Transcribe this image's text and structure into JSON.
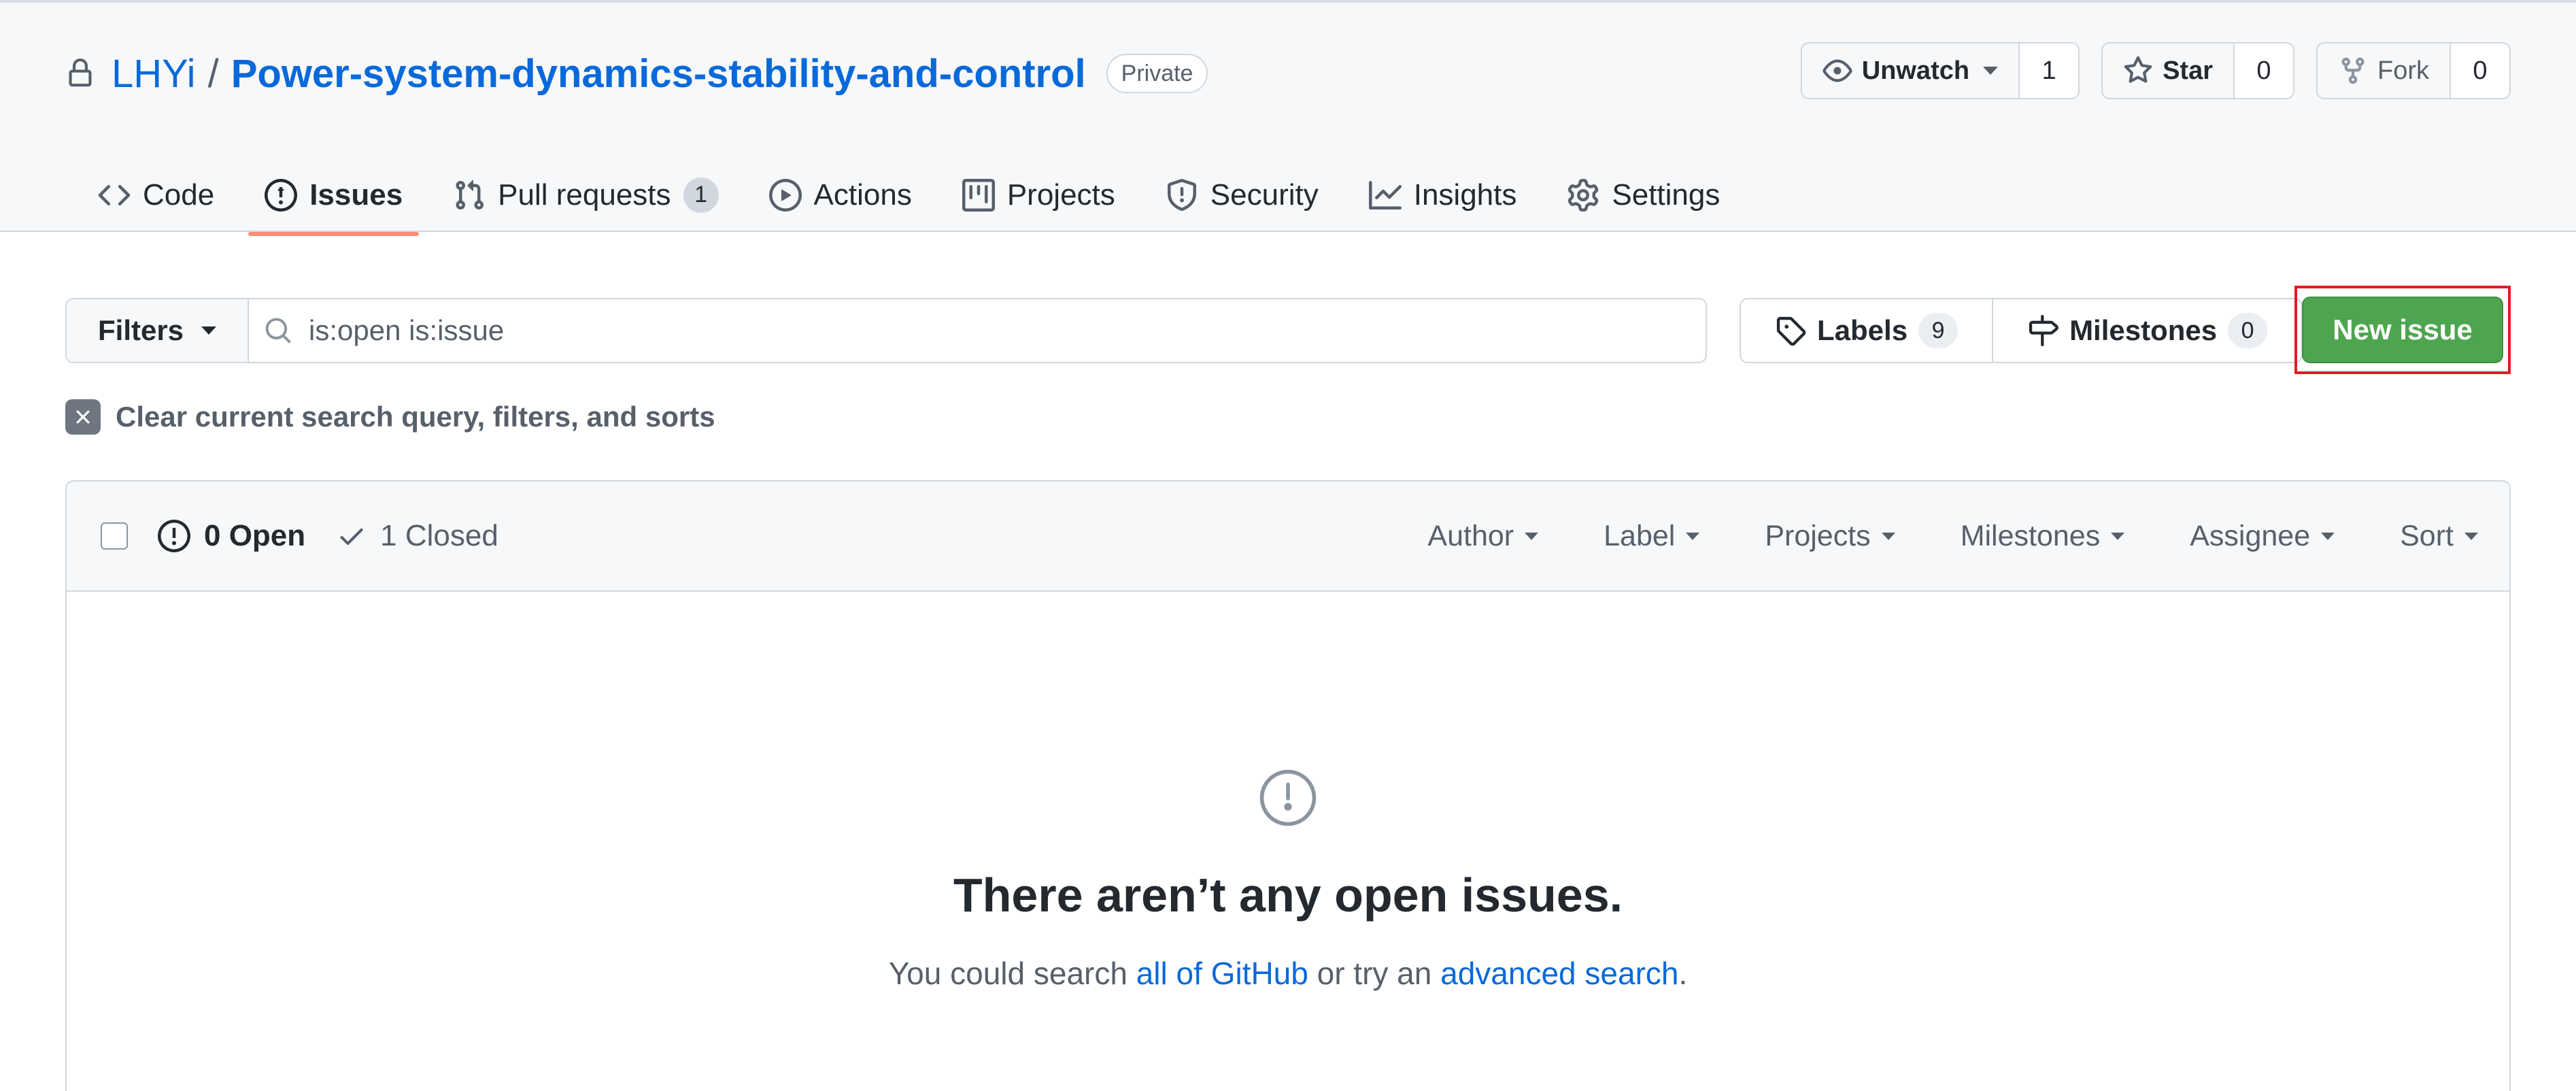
{
  "repo": {
    "owner": "LHYi",
    "separator": "/",
    "name": "Power-system-dynamics-stability-and-control",
    "visibility": "Private"
  },
  "actions": {
    "watch": {
      "label": "Unwatch",
      "count": "1"
    },
    "star": {
      "label": "Star",
      "count": "0"
    },
    "fork": {
      "label": "Fork",
      "count": "0"
    }
  },
  "tabs": [
    {
      "label": "Code",
      "icon": "code-icon"
    },
    {
      "label": "Issues",
      "icon": "issue-opened-icon",
      "selected": true
    },
    {
      "label": "Pull requests",
      "icon": "git-pull-request-icon",
      "counter": "1"
    },
    {
      "label": "Actions",
      "icon": "play-icon"
    },
    {
      "label": "Projects",
      "icon": "table-icon"
    },
    {
      "label": "Security",
      "icon": "shield-icon"
    },
    {
      "label": "Insights",
      "icon": "graph-icon"
    },
    {
      "label": "Settings",
      "icon": "gear-icon"
    }
  ],
  "subnav": {
    "filters_label": "Filters",
    "search_value": "is:open is:issue",
    "labels": {
      "label": "Labels",
      "count": "9"
    },
    "milestones": {
      "label": "Milestones",
      "count": "0"
    },
    "new_issue_label": "New issue"
  },
  "clear_filters_label": "Clear current search query, filters, and sorts",
  "issues_header": {
    "open_label": "0 Open",
    "closed_label": "1 Closed",
    "filters": [
      "Author",
      "Label",
      "Projects",
      "Milestones",
      "Assignee",
      "Sort"
    ]
  },
  "blankslate": {
    "title": "There aren’t any open issues.",
    "text_prefix": "You could search ",
    "link1": "all of GitHub",
    "text_middle": " or try an ",
    "link2": "advanced search",
    "text_suffix": "."
  },
  "colors": {
    "link": "#0969da",
    "new_issue_bg": "#4ea54f",
    "selected_tab_underline": "#fd8c73",
    "highlight_box": "#e01b24"
  }
}
